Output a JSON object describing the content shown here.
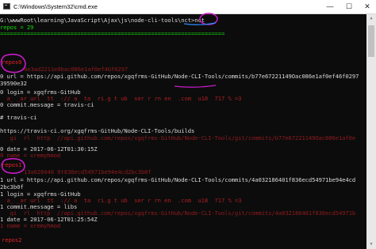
{
  "window": {
    "title": "C:\\Windows\\System32\\cmd.exe",
    "minimize_glyph": "—",
    "maximize_glyph": "☐",
    "close_glyph": "✕"
  },
  "console": {
    "prompt_path": "G:\\wwwRoot\\learning\\JavaScript\\Ajax\\js\\node-cli-tools\\nct>",
    "command": "nct",
    "repos_count": "repos = 29",
    "separator": "===================================================================",
    "repos0": {
      "label": "repos0",
      "overlay1": "4e3ad2211e0bac086e1af0ef4Gf0297",
      "overlay2": "39590e32",
      "url": "0 url = https://api.github.com/repos/xgqfrms-GitHub/Node-CLI-Tools/commits/b77e67221149Oac086e1af0ef46f0297",
      "hash_tail": "39590e32",
      "login": "0 login = xgqfrms-GitHub",
      "noise": "  a_ _ar url  tt  :// a  ta  ri.g t ub  ser r rn en  .com  u18  717 % =3",
      "commit_message": "0 commit.message = travis-ci",
      "hash_title": "# travis-ci",
      "build_url": "https://travis-ci.org/xgqfrms-GitHub/Node-CLI-Tools/builds",
      "overlay3": "   gi  rl  http  //api.github.com/repos/xgqfrms-GitHub/Node-CLI-Tools/git/commits/b77e67221149Oac086e1af0e",
      "date": "0 date = 2017-06-12T01:30:15Z",
      "overlay4": "0 name = xremyhmod"
    },
    "repos1": {
      "label": "repos1",
      "overlay1": "13a026046 0t836ecd54971be94e4cd2bc3b0f",
      "overlay2": "2bc3b0f",
      "url": "1 url = https://api.github.com/repos/xgqfrms-GitHub/Node-CLI-Tools/commits/4a032186401f836ecd54971be94e4cd",
      "hash_tail": "2bc3b0f",
      "login": "1 login = xgqfrms-GitHub",
      "noise": "  a_ _ar url  tt  :// a  ta  ri.g t ub  ser r rn en  .com  u18  717 % =3",
      "commit_message": "1 commit.message = libs",
      "overlay3": "   gi  rl  http  //api.github.com/repos/xgqfrms-GitHub/Node-CLI-Tools/git/commits/4a032186401f836ecd54971b",
      "date": "1 date = 2017-06-12T01:25:54Z",
      "overlay4": "1 name = xremyhmod"
    },
    "repos2": {
      "label": "repos2"
    }
  },
  "colors": {
    "background": "#0c0c0c",
    "text_green": "#16d60c",
    "text_red": "#e0242a",
    "text_white": "#d9d9d9",
    "annotation_magenta": "#c81bc8",
    "annotation_blue": "#2f8cff"
  }
}
